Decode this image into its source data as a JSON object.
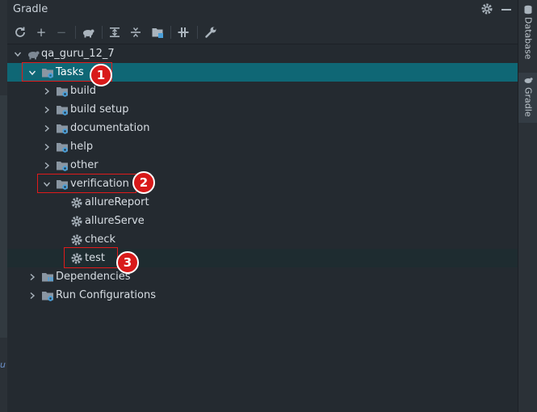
{
  "panel": {
    "title": "Gradle"
  },
  "left_strip": {
    "fragment": "u"
  },
  "right_sidebar": {
    "tabs": [
      {
        "label": "Database"
      },
      {
        "label": "Gradle"
      }
    ]
  },
  "toolbar": {
    "buttons": [
      {
        "name": "reload-icon",
        "symbol": "⟳"
      },
      {
        "name": "add-icon",
        "symbol": "+"
      },
      {
        "name": "remove-icon",
        "symbol": "−"
      },
      {
        "name": "run-task-icon"
      },
      {
        "name": "expand-all-icon"
      },
      {
        "name": "collapse-all-icon"
      },
      {
        "name": "open-config-icon"
      },
      {
        "name": "toggle-offline-icon"
      },
      {
        "name": "settings-wrench-icon"
      }
    ]
  },
  "tree": {
    "project": "qa_guru_12_7",
    "tasks_label": "Tasks",
    "task_groups": [
      "build",
      "build setup",
      "documentation",
      "help",
      "other"
    ],
    "verification": {
      "label": "verification",
      "tasks": [
        "allureReport",
        "allureServe",
        "check",
        "test"
      ]
    },
    "dependencies_label": "Dependencies",
    "run_configurations_label": "Run Configurations"
  },
  "annotations": [
    {
      "number": "1"
    },
    {
      "number": "2"
    },
    {
      "number": "3"
    }
  ],
  "colors": {
    "selection": "#0f6775",
    "annotation": "#d81a1a",
    "folder": "#8a96a2",
    "gear_badge": "#4a9fd8"
  }
}
